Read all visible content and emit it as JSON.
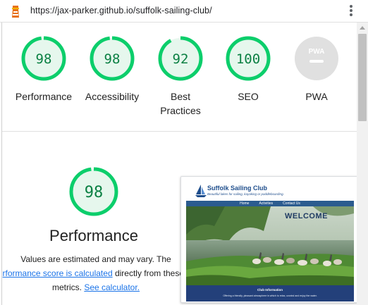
{
  "url_bar": {
    "url": "https://jax-parker.github.io/suffolk-sailing-club/",
    "icon": "lighthouse-icon",
    "menu_icon": "kebab-menu-icon"
  },
  "colors": {
    "pass_green": "#0cce6b",
    "pass_text": "#0b8043",
    "pass_bg": "#e6f7ed",
    "pwa_grey": "#e0e0e0",
    "link_blue": "#1a73e8"
  },
  "scores": [
    {
      "label": "Performance",
      "value": "98",
      "fraction": 0.98
    },
    {
      "label": "Accessibility",
      "value": "98",
      "fraction": 0.98
    },
    {
      "label": "Best Practices",
      "value": "92",
      "fraction": 0.92
    },
    {
      "label": "SEO",
      "value": "100",
      "fraction": 1.0
    },
    {
      "label": "PWA",
      "value": "PWA",
      "fraction": null
    }
  ],
  "performance": {
    "score": "98",
    "fraction": 0.98,
    "title": "Performance",
    "desc_line1": "Values are estimated and may vary. The",
    "desc_link1": "rformance score is calculated",
    "desc_line2_rest": " directly from these",
    "desc_line3_pre": "metrics. ",
    "desc_link2": "See calculator."
  },
  "screenshot": {
    "site_title": "Suffolk Sailing Club",
    "tagline": "Beautiful lakes for sailing, kayaking or paddleboarding.",
    "nav": [
      "Home",
      "Activities",
      "Contact Us"
    ],
    "hero_text": "WELCOME",
    "info_title": "Club Information",
    "info_text": "Offering a friendly, pleasant atmosphere in which to relax, unwind and enjoy the water."
  }
}
